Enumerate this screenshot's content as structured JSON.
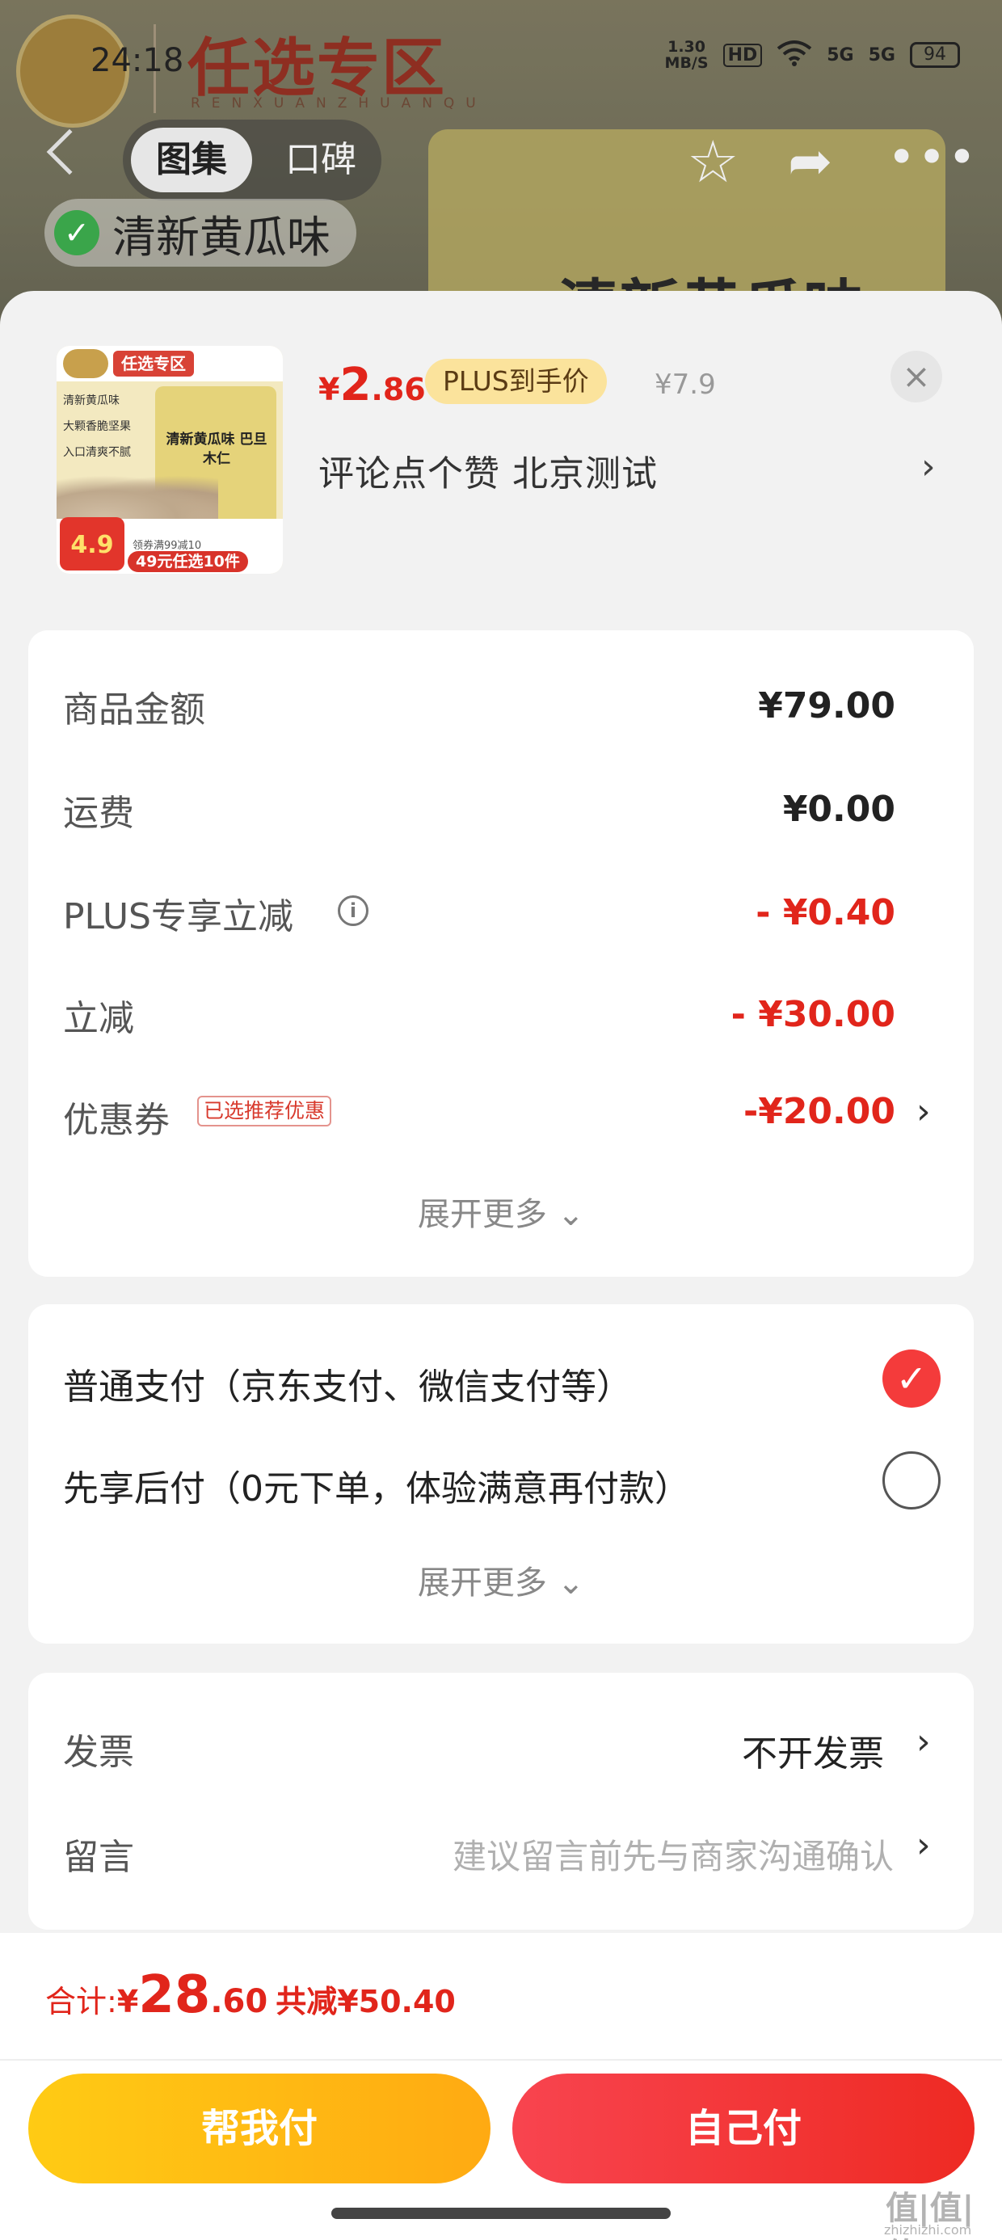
{
  "status_bar": {
    "time": "24:18",
    "speed_value": "1.30",
    "speed_unit": "MB/S",
    "hd": "HD",
    "sig1": "5G",
    "sig2": "5G",
    "battery": "94"
  },
  "background": {
    "zone_title": "任选专区",
    "zone_subtitle": "RENXUANZHUANQU",
    "tabs": [
      "图集",
      "口碑"
    ],
    "flavor_tag": "清新黄瓜味",
    "pack_title": "清新黄瓜味"
  },
  "product": {
    "thumbnail": {
      "badge": "任选专区",
      "features": [
        "清新黄瓜味",
        "大颗香脆坚果",
        "入口清爽不腻"
      ],
      "pack_title": "清新黄瓜味 巴旦木仁",
      "price_tag": "4.9",
      "price_note": "领券满99减10",
      "price_bar": "49元任选10件"
    },
    "price_symbol": "¥",
    "price_integer": "2",
    "price_decimal": ".86",
    "plus_label": "PLUS到手价",
    "original_price": "¥7.9",
    "close_glyph": "×",
    "spec_text": "评论点个赞  北京测试",
    "spec_chevron": "›"
  },
  "costs": {
    "rows": [
      {
        "label": "商品金额",
        "value": "¥79.00"
      },
      {
        "label": "运费",
        "value": "¥0.00"
      },
      {
        "label": "PLUS专享立减",
        "value": "- ¥0.40"
      },
      {
        "label": "立减",
        "value": "- ¥30.00"
      },
      {
        "label": "优惠券",
        "value": "-¥20.00"
      }
    ],
    "info_glyph": "i",
    "coupon_tag": "已选推荐优惠",
    "chevron": "›",
    "expand": "展开更多 ⌄"
  },
  "payment": {
    "options": [
      {
        "label": "普通支付（京东支付、微信支付等）",
        "selected": true
      },
      {
        "label": "先享后付（0元下单，体验满意再付款）",
        "selected": false
      }
    ],
    "check_glyph": "✓",
    "expand": "展开更多 ⌄"
  },
  "extras": {
    "invoice_label": "发票",
    "invoice_value": "不开发票",
    "message_label": "留言",
    "message_placeholder": "建议留言前先与商家沟通确认",
    "chevron": "›"
  },
  "footer": {
    "total_label": "合计: ",
    "total_symbol": "¥",
    "total_integer": "28",
    "total_decimal": ".60",
    "savings": "共减¥50.40",
    "help_pay": "帮我付",
    "self_pay": "自己付"
  },
  "watermark": {
    "text": "值|值|值",
    "sub": "zhizhizhi.com"
  },
  "colors": {
    "accent_red": "#e1251b",
    "plus_gold": "#fbe39c",
    "help_btn": "#ffb912",
    "self_btn": "#f3383a"
  }
}
